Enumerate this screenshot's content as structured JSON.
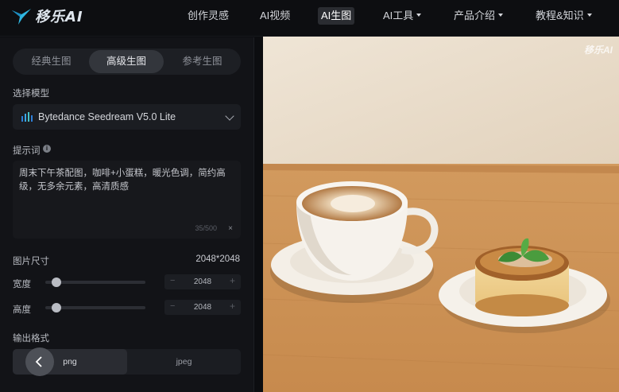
{
  "brand": {
    "name": "移乐AI",
    "accent": "#2fb6e0"
  },
  "nav": [
    {
      "label": "创作灵感",
      "has_caret": false,
      "active": false
    },
    {
      "label": "AI视频",
      "has_caret": false,
      "active": false
    },
    {
      "label": "AI生图",
      "has_caret": false,
      "active": true
    },
    {
      "label": "AI工具",
      "has_caret": true,
      "active": false
    },
    {
      "label": "产品介绍",
      "has_caret": true,
      "active": false
    },
    {
      "label": "教程&知识",
      "has_caret": true,
      "active": false
    }
  ],
  "tabs": [
    {
      "label": "经典生图",
      "active": false
    },
    {
      "label": "高级生图",
      "active": true
    },
    {
      "label": "参考生图",
      "active": false
    }
  ],
  "model": {
    "label": "选择模型",
    "selected": "Bytedance Seedream V5.0 Lite"
  },
  "prompt": {
    "label": "提示词",
    "value": "周末下午茶配图，咖啡+小蛋糕，暖光色调，简约高级，无多余元素，高清质感",
    "count": "35/500",
    "clear": "×"
  },
  "size": {
    "label": "图片尺寸",
    "value": "2048*2048",
    "width": {
      "label": "宽度",
      "value": "2048",
      "minus": "−",
      "plus": "+",
      "level": 0.07
    },
    "height": {
      "label": "高度",
      "value": "2048",
      "minus": "−",
      "plus": "+",
      "level": 0.07
    }
  },
  "format": {
    "label": "输出格式",
    "options": [
      {
        "label": "png",
        "active": true
      },
      {
        "label": "jpeg",
        "active": false
      }
    ]
  },
  "preview": {
    "watermark": "移乐AI"
  }
}
